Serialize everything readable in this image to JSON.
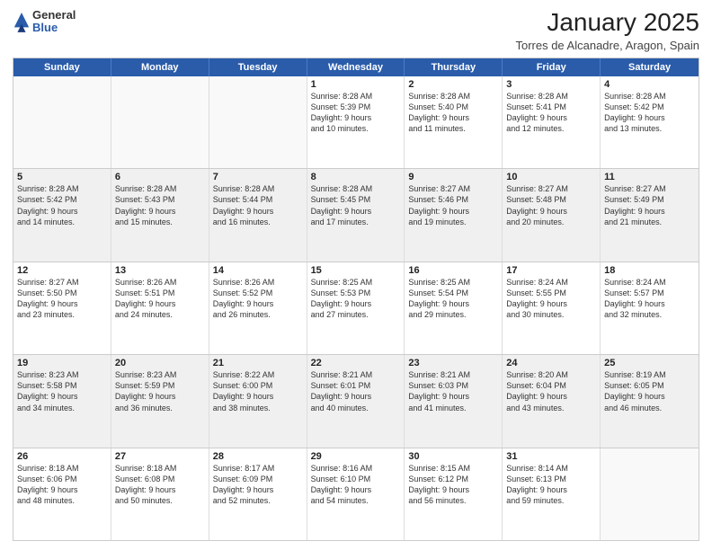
{
  "logo": {
    "general": "General",
    "blue": "Blue"
  },
  "title": "January 2025",
  "location": "Torres de Alcanadre, Aragon, Spain",
  "weekdays": [
    "Sunday",
    "Monday",
    "Tuesday",
    "Wednesday",
    "Thursday",
    "Friday",
    "Saturday"
  ],
  "weeks": [
    [
      {
        "day": "",
        "text": "",
        "empty": true
      },
      {
        "day": "",
        "text": "",
        "empty": true
      },
      {
        "day": "",
        "text": "",
        "empty": true
      },
      {
        "day": "1",
        "text": "Sunrise: 8:28 AM\nSunset: 5:39 PM\nDaylight: 9 hours\nand 10 minutes."
      },
      {
        "day": "2",
        "text": "Sunrise: 8:28 AM\nSunset: 5:40 PM\nDaylight: 9 hours\nand 11 minutes."
      },
      {
        "day": "3",
        "text": "Sunrise: 8:28 AM\nSunset: 5:41 PM\nDaylight: 9 hours\nand 12 minutes."
      },
      {
        "day": "4",
        "text": "Sunrise: 8:28 AM\nSunset: 5:42 PM\nDaylight: 9 hours\nand 13 minutes."
      }
    ],
    [
      {
        "day": "5",
        "text": "Sunrise: 8:28 AM\nSunset: 5:42 PM\nDaylight: 9 hours\nand 14 minutes."
      },
      {
        "day": "6",
        "text": "Sunrise: 8:28 AM\nSunset: 5:43 PM\nDaylight: 9 hours\nand 15 minutes."
      },
      {
        "day": "7",
        "text": "Sunrise: 8:28 AM\nSunset: 5:44 PM\nDaylight: 9 hours\nand 16 minutes."
      },
      {
        "day": "8",
        "text": "Sunrise: 8:28 AM\nSunset: 5:45 PM\nDaylight: 9 hours\nand 17 minutes."
      },
      {
        "day": "9",
        "text": "Sunrise: 8:27 AM\nSunset: 5:46 PM\nDaylight: 9 hours\nand 19 minutes."
      },
      {
        "day": "10",
        "text": "Sunrise: 8:27 AM\nSunset: 5:48 PM\nDaylight: 9 hours\nand 20 minutes."
      },
      {
        "day": "11",
        "text": "Sunrise: 8:27 AM\nSunset: 5:49 PM\nDaylight: 9 hours\nand 21 minutes."
      }
    ],
    [
      {
        "day": "12",
        "text": "Sunrise: 8:27 AM\nSunset: 5:50 PM\nDaylight: 9 hours\nand 23 minutes."
      },
      {
        "day": "13",
        "text": "Sunrise: 8:26 AM\nSunset: 5:51 PM\nDaylight: 9 hours\nand 24 minutes."
      },
      {
        "day": "14",
        "text": "Sunrise: 8:26 AM\nSunset: 5:52 PM\nDaylight: 9 hours\nand 26 minutes."
      },
      {
        "day": "15",
        "text": "Sunrise: 8:25 AM\nSunset: 5:53 PM\nDaylight: 9 hours\nand 27 minutes."
      },
      {
        "day": "16",
        "text": "Sunrise: 8:25 AM\nSunset: 5:54 PM\nDaylight: 9 hours\nand 29 minutes."
      },
      {
        "day": "17",
        "text": "Sunrise: 8:24 AM\nSunset: 5:55 PM\nDaylight: 9 hours\nand 30 minutes."
      },
      {
        "day": "18",
        "text": "Sunrise: 8:24 AM\nSunset: 5:57 PM\nDaylight: 9 hours\nand 32 minutes."
      }
    ],
    [
      {
        "day": "19",
        "text": "Sunrise: 8:23 AM\nSunset: 5:58 PM\nDaylight: 9 hours\nand 34 minutes."
      },
      {
        "day": "20",
        "text": "Sunrise: 8:23 AM\nSunset: 5:59 PM\nDaylight: 9 hours\nand 36 minutes."
      },
      {
        "day": "21",
        "text": "Sunrise: 8:22 AM\nSunset: 6:00 PM\nDaylight: 9 hours\nand 38 minutes."
      },
      {
        "day": "22",
        "text": "Sunrise: 8:21 AM\nSunset: 6:01 PM\nDaylight: 9 hours\nand 40 minutes."
      },
      {
        "day": "23",
        "text": "Sunrise: 8:21 AM\nSunset: 6:03 PM\nDaylight: 9 hours\nand 41 minutes."
      },
      {
        "day": "24",
        "text": "Sunrise: 8:20 AM\nSunset: 6:04 PM\nDaylight: 9 hours\nand 43 minutes."
      },
      {
        "day": "25",
        "text": "Sunrise: 8:19 AM\nSunset: 6:05 PM\nDaylight: 9 hours\nand 46 minutes."
      }
    ],
    [
      {
        "day": "26",
        "text": "Sunrise: 8:18 AM\nSunset: 6:06 PM\nDaylight: 9 hours\nand 48 minutes."
      },
      {
        "day": "27",
        "text": "Sunrise: 8:18 AM\nSunset: 6:08 PM\nDaylight: 9 hours\nand 50 minutes."
      },
      {
        "day": "28",
        "text": "Sunrise: 8:17 AM\nSunset: 6:09 PM\nDaylight: 9 hours\nand 52 minutes."
      },
      {
        "day": "29",
        "text": "Sunrise: 8:16 AM\nSunset: 6:10 PM\nDaylight: 9 hours\nand 54 minutes."
      },
      {
        "day": "30",
        "text": "Sunrise: 8:15 AM\nSunset: 6:12 PM\nDaylight: 9 hours\nand 56 minutes."
      },
      {
        "day": "31",
        "text": "Sunrise: 8:14 AM\nSunset: 6:13 PM\nDaylight: 9 hours\nand 59 minutes."
      },
      {
        "day": "",
        "text": "",
        "empty": true
      }
    ]
  ]
}
